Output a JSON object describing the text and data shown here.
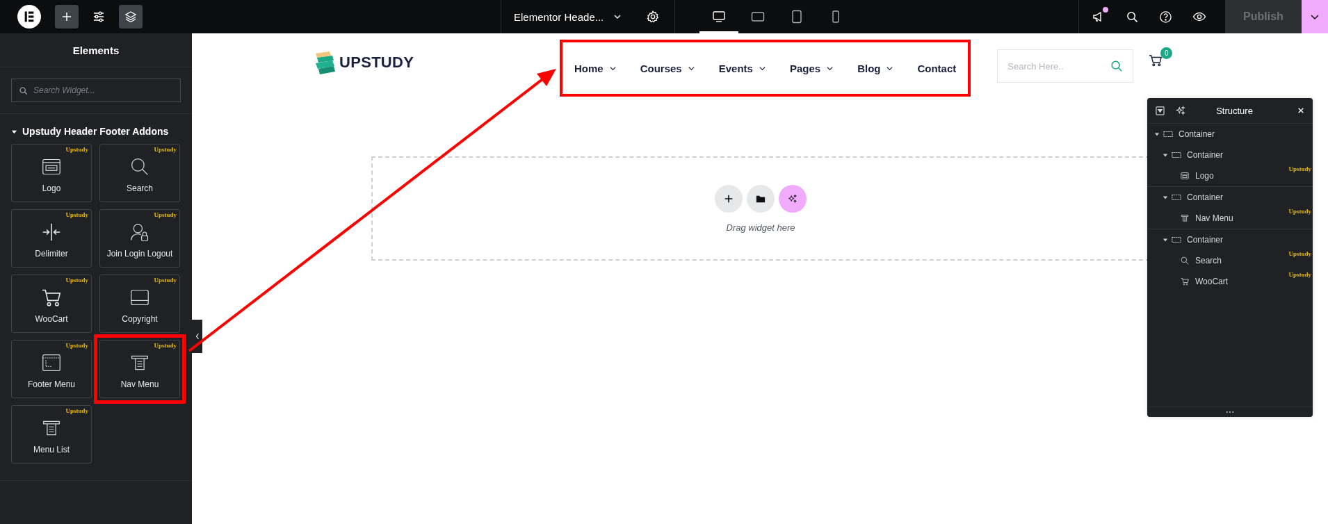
{
  "top_bar": {
    "document_title": "Elementor Heade...",
    "devices": [
      {
        "kind": "desktop",
        "selected": true
      },
      {
        "kind": "tablet-landscape",
        "selected": false
      },
      {
        "kind": "tablet",
        "selected": false
      },
      {
        "kind": "mobile",
        "selected": false
      }
    ],
    "has_notification": true,
    "publish": {
      "label": "Publish",
      "disabled": true
    }
  },
  "elements_panel": {
    "title": "Elements",
    "search": {
      "placeholder": "Search Widget..."
    },
    "category": {
      "title": "Upstudy Header Footer Addons",
      "expanded": true
    },
    "widgets": [
      {
        "label": "Logo",
        "badge": "Upstudy",
        "kind": "logo",
        "highlighted": false
      },
      {
        "label": "Search",
        "badge": "Upstudy",
        "kind": "search",
        "highlighted": false
      },
      {
        "label": "Delimiter",
        "badge": "Upstudy",
        "kind": "delimiter",
        "highlighted": false
      },
      {
        "label": "Join Login Logout",
        "badge": "Upstudy",
        "kind": "user-lock",
        "highlighted": false
      },
      {
        "label": "WooCart",
        "badge": "Upstudy",
        "kind": "cart",
        "highlighted": false
      },
      {
        "label": "Copyright",
        "badge": "Upstudy",
        "kind": "copyright",
        "highlighted": false
      },
      {
        "label": "Footer Menu",
        "badge": "Upstudy",
        "kind": "footer-menu",
        "highlighted": false
      },
      {
        "label": "Nav Menu",
        "badge": "Upstudy",
        "kind": "nav-menu",
        "highlighted": true
      },
      {
        "label": "Menu List",
        "badge": "Upstudy",
        "kind": "nav-menu",
        "highlighted": false
      }
    ]
  },
  "page": {
    "logo": "UPSTUDY",
    "nav": {
      "highlighted": true,
      "items": [
        {
          "label": "Home",
          "has_submenu": true
        },
        {
          "label": "Courses",
          "has_submenu": true
        },
        {
          "label": "Events",
          "has_submenu": true
        },
        {
          "label": "Pages",
          "has_submenu": true
        },
        {
          "label": "Blog",
          "has_submenu": true
        },
        {
          "label": "Contact",
          "has_submenu": false
        }
      ]
    },
    "search": {
      "placeholder": "Search Here.."
    },
    "cart_count": "0",
    "drop_zone": {
      "hint": "Drag widget here"
    }
  },
  "structure": {
    "title": "Structure",
    "items": [
      {
        "label": "Container",
        "kind": "container",
        "expanded": true,
        "children": [
          {
            "label": "Container",
            "kind": "container",
            "expanded": true,
            "children": [
              {
                "label": "Logo",
                "kind": "logo",
                "badge": "Upstudy"
              }
            ]
          },
          {
            "label": "Container",
            "kind": "container",
            "expanded": true,
            "children": [
              {
                "label": "Nav Menu",
                "kind": "nav-menu",
                "badge": "Upstudy"
              }
            ]
          },
          {
            "label": "Container",
            "kind": "container",
            "expanded": true,
            "children": [
              {
                "label": "Search",
                "kind": "search",
                "badge": "Upstudy"
              },
              {
                "label": "WooCart",
                "kind": "cart",
                "badge": "Upstudy"
              }
            ]
          }
        ]
      }
    ]
  }
}
